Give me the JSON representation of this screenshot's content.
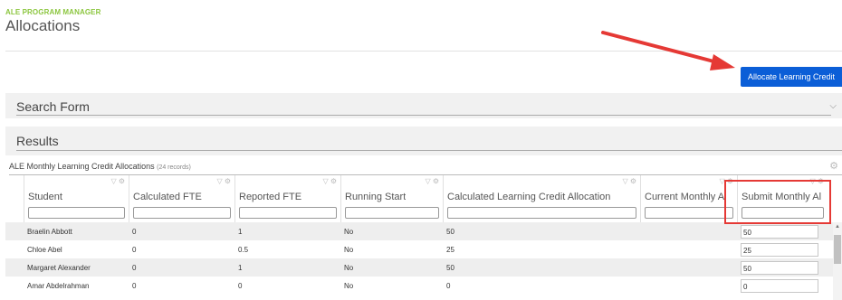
{
  "app": {
    "label": "ALE PROGRAM MANAGER",
    "title": "Allocations"
  },
  "actions": {
    "allocate_label": "Allocate Learning Credit"
  },
  "search_panel": {
    "title": "Search Form",
    "chevron_icon": "chevron-down-icon"
  },
  "results_panel": {
    "title": "Results"
  },
  "grid": {
    "caption": "ALE Monthly Learning Credit Allocations",
    "record_count": "(24 records)",
    "columns": [
      {
        "label": "Student"
      },
      {
        "label": "Calculated FTE"
      },
      {
        "label": "Reported FTE"
      },
      {
        "label": "Running Start"
      },
      {
        "label": "Calculated Learning Credit Allocation"
      },
      {
        "label": "Current Monthly A"
      },
      {
        "label": "Submit Monthly Al"
      }
    ],
    "rows": [
      {
        "student": "Braelin Abbott",
        "calc_fte": "0",
        "reported_fte": "1",
        "running_start": "No",
        "calc_allocation": "50",
        "current_monthly": "",
        "submit_monthly": "50"
      },
      {
        "student": "Chloe Abel",
        "calc_fte": "0",
        "reported_fte": "0.5",
        "running_start": "No",
        "calc_allocation": "25",
        "current_monthly": "",
        "submit_monthly": "25"
      },
      {
        "student": "Margaret Alexander",
        "calc_fte": "0",
        "reported_fte": "1",
        "running_start": "No",
        "calc_allocation": "50",
        "current_monthly": "",
        "submit_monthly": "50"
      },
      {
        "student": "Amar Abdelrahman",
        "calc_fte": "0",
        "reported_fte": "0",
        "running_start": "No",
        "calc_allocation": "0",
        "current_monthly": "",
        "submit_monthly": "0"
      }
    ]
  },
  "colors": {
    "brand_green": "#8cc63f",
    "primary_button": "#0b5ed7",
    "annotation_red": "#e53935"
  }
}
